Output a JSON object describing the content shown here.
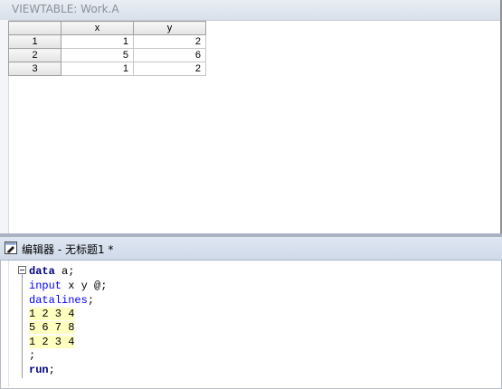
{
  "viewtable": {
    "title": "VIEWTABLE: Work.A",
    "columns": [
      "x",
      "y"
    ],
    "rows": [
      {
        "row": "1",
        "x": "1",
        "y": "2"
      },
      {
        "row": "2",
        "x": "5",
        "y": "6"
      },
      {
        "row": "3",
        "x": "1",
        "y": "2"
      }
    ]
  },
  "editor": {
    "title": "编辑器 - 无标题1 *",
    "code": {
      "line1_kw": "data",
      "line1_rest": " a;",
      "line2_kw": "input",
      "line2_rest": " x y @;",
      "line3_kw": "datalines",
      "line3_rest": ";",
      "line4": "1 2 3 4",
      "line5": "5 6 7 8",
      "line6": "1 2 3 4",
      "line7": ";",
      "line8_kw": "run",
      "line8_rest": ";"
    }
  }
}
